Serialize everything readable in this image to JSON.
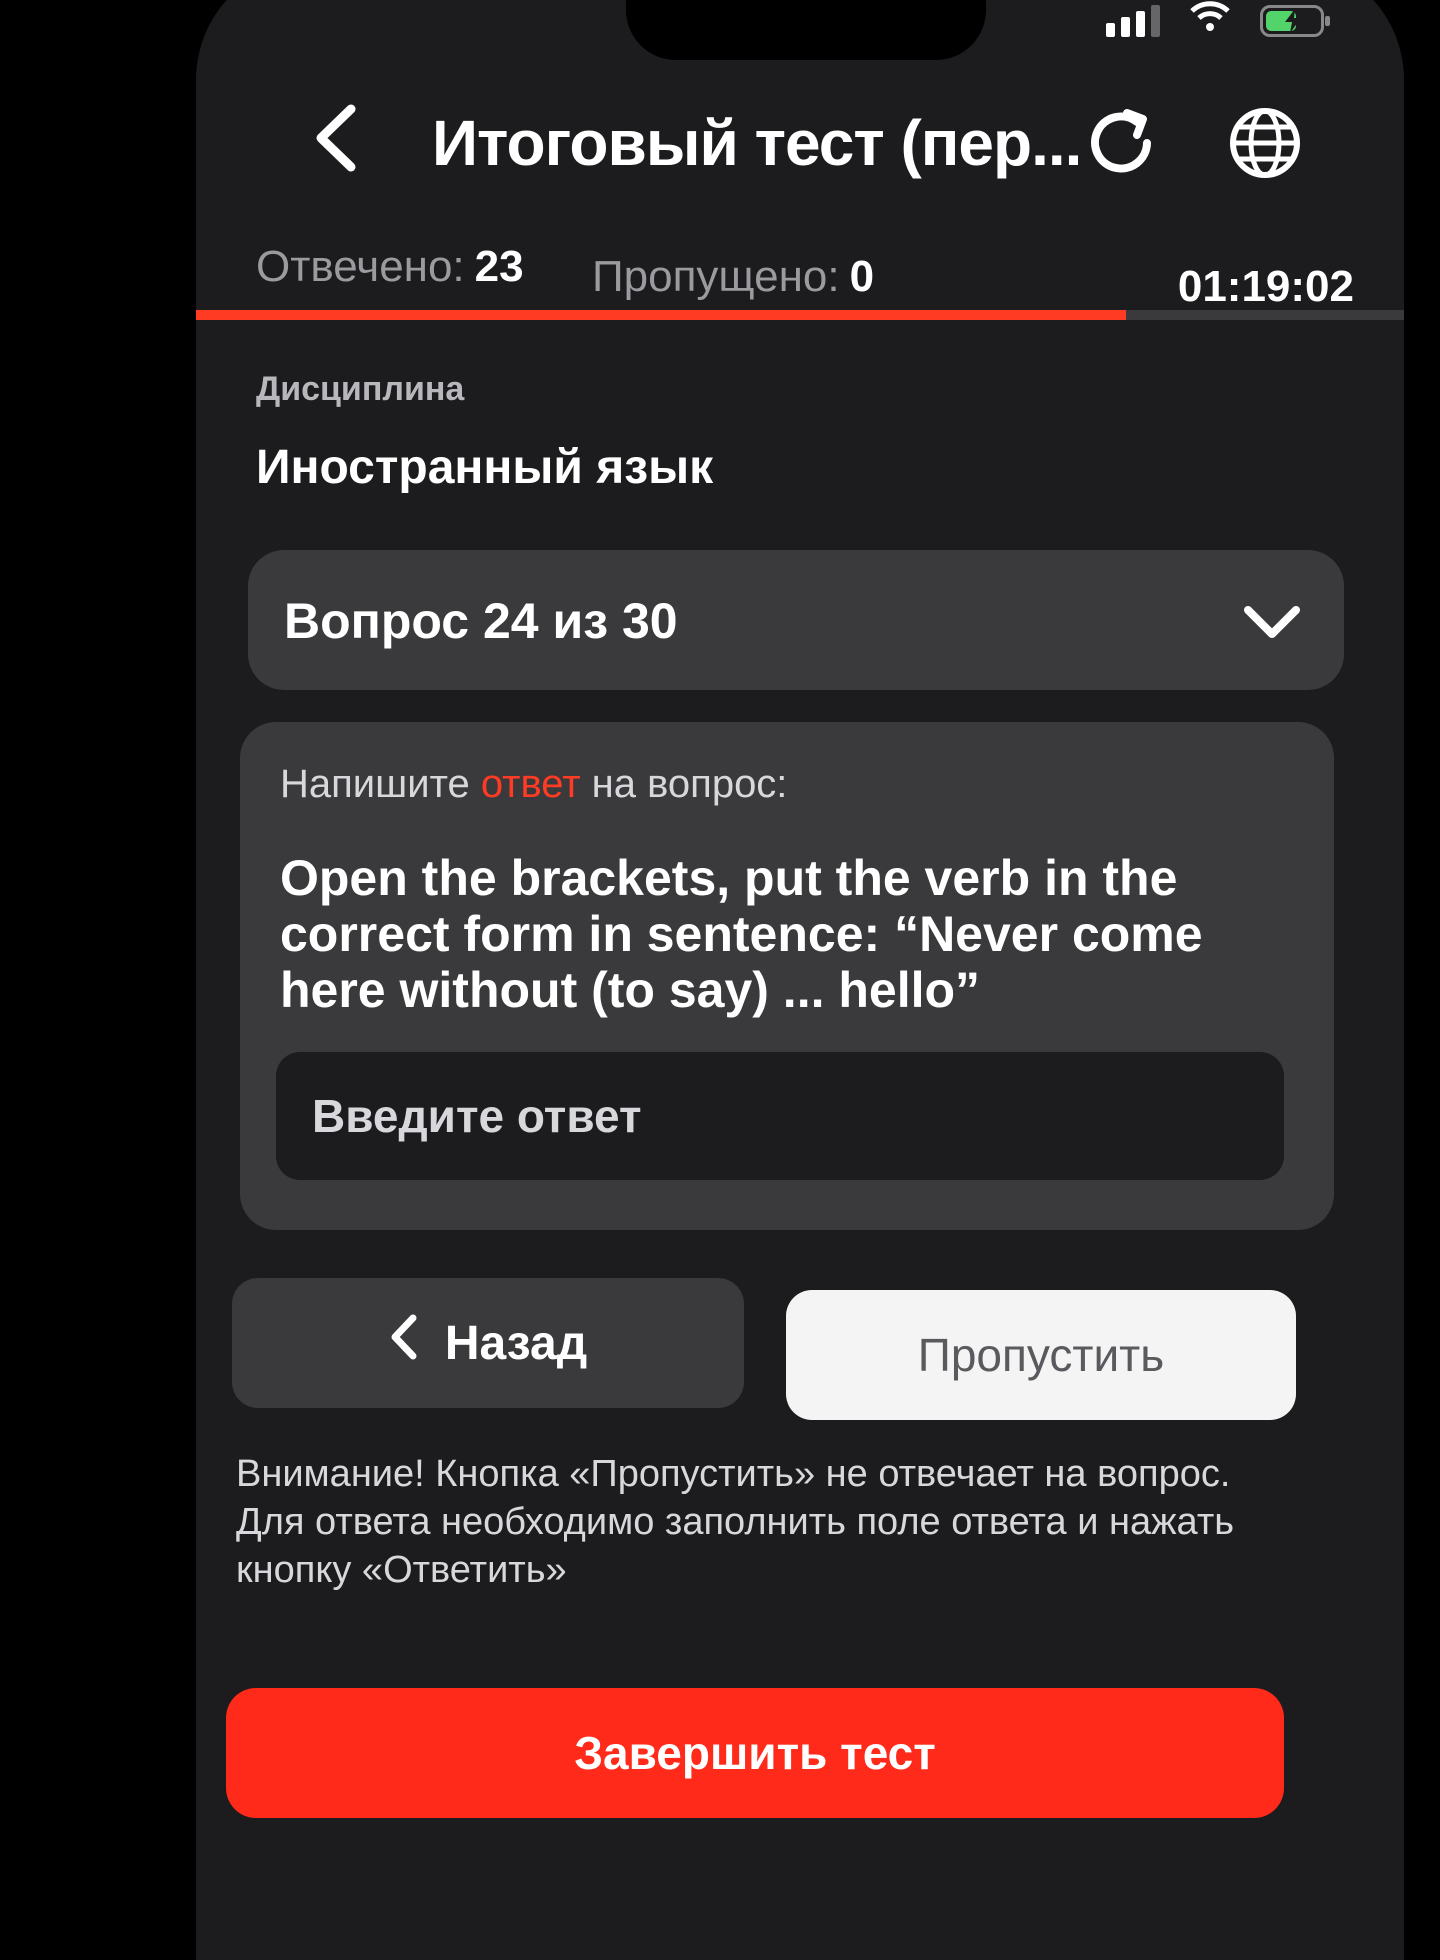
{
  "status_bar": {
    "icons": [
      "signal-icon",
      "wifi-icon",
      "battery-charging-icon"
    ],
    "battery_color": "#52d46a"
  },
  "header": {
    "title": "Итоговый тест (пер...",
    "icons": [
      "back-icon",
      "refresh-icon",
      "globe-icon"
    ]
  },
  "stats": {
    "answered_label": "Отвечено:",
    "answered_value": "23",
    "skipped_label": "Пропущено:",
    "skipped_value": "0",
    "timer": "01:19:02",
    "progress_fraction": 0.77
  },
  "discipline": {
    "label": "Дисциплина",
    "value": "Иностранный язык"
  },
  "question_selector": {
    "label": "Вопрос 24 из 30"
  },
  "question": {
    "prompt_before": "Напишите ",
    "prompt_accent": "ответ",
    "prompt_after": " на вопрос:",
    "text": "Open the brackets, put the verb in the correct form in sentence: “Never come here without (to say) ... hello”",
    "input_value": "",
    "input_placeholder": "Введите ответ"
  },
  "actions": {
    "back_label": "Назад",
    "skip_label": "Пропустить",
    "finish_label": "Завершить тест"
  },
  "warning": "Внимание! Кнопка «Пропустить» не отвечает на вопрос. Для ответа необходимо заполнить поле ответа и нажать кнопку «Ответить»",
  "colors": {
    "accent": "#ff3b24",
    "background": "#1c1c1e",
    "card": "#3a3a3c"
  }
}
